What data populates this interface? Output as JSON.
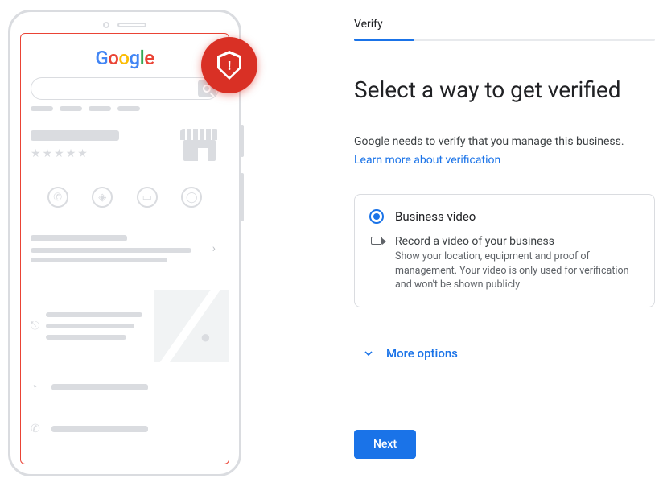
{
  "step_label": "Verify",
  "heading": "Select a way to get verified",
  "description": "Google needs to verify that you manage this business.",
  "learn_more": "Learn more about verification",
  "option": {
    "title": "Business video",
    "subtitle": "Record a video of your business",
    "detail": "Show your location, equipment and proof of management. Your video is only used for verification and won't be shown publicly"
  },
  "more_options": "More options",
  "next": "Next",
  "logo": {
    "g1": "G",
    "o1": "o",
    "o2": "o",
    "g2": "g",
    "l": "l",
    "e": "e"
  }
}
